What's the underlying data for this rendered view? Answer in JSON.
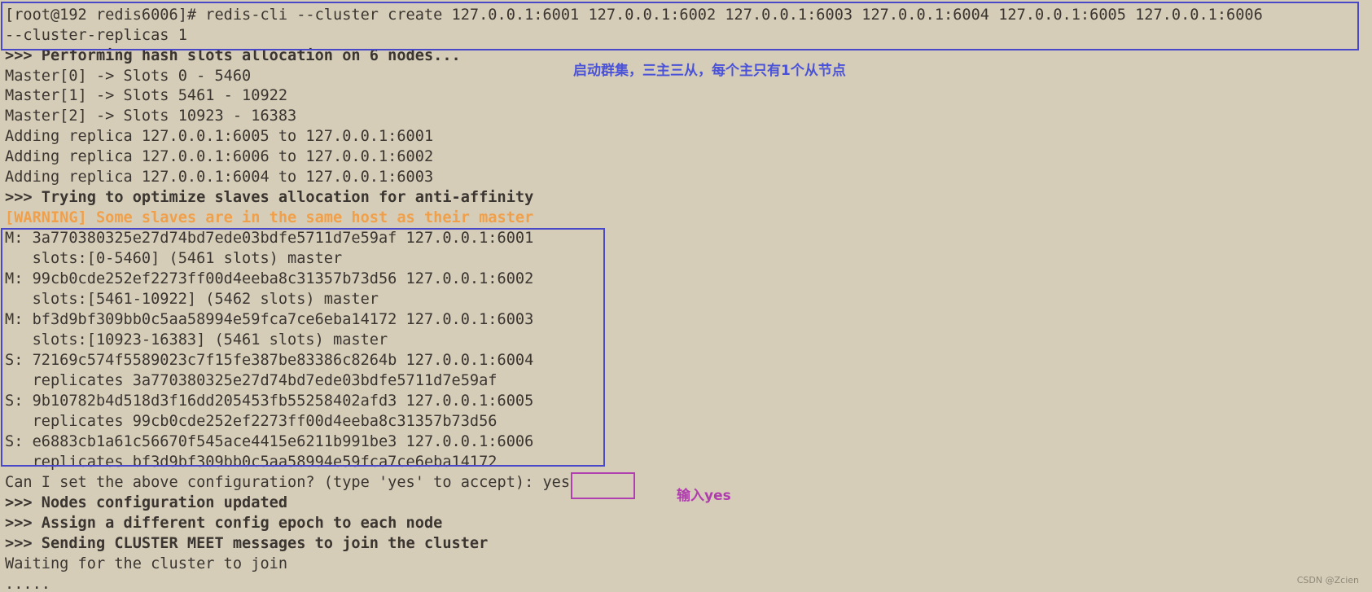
{
  "terminal": {
    "lines": [
      {
        "text": "[root@192 redis6006]# redis-cli --cluster create 127.0.0.1:6001 127.0.0.1:6002 127.0.0.1:6003 127.0.0.1:6004 127.0.0.1:6005 127.0.0.1:6006",
        "style": "normal"
      },
      {
        "text": "--cluster-replicas 1",
        "style": "normal"
      },
      {
        "text": ">>> Performing hash slots allocation on 6 nodes...",
        "style": "bold"
      },
      {
        "text": "Master[0] -> Slots 0 - 5460",
        "style": "normal"
      },
      {
        "text": "Master[1] -> Slots 5461 - 10922",
        "style": "normal"
      },
      {
        "text": "Master[2] -> Slots 10923 - 16383",
        "style": "normal"
      },
      {
        "text": "Adding replica 127.0.0.1:6005 to 127.0.0.1:6001",
        "style": "normal"
      },
      {
        "text": "Adding replica 127.0.0.1:6006 to 127.0.0.1:6002",
        "style": "normal"
      },
      {
        "text": "Adding replica 127.0.0.1:6004 to 127.0.0.1:6003",
        "style": "normal"
      },
      {
        "text": ">>> Trying to optimize slaves allocation for anti-affinity",
        "style": "bold"
      },
      {
        "text": "[WARNING] Some slaves are in the same host as their master",
        "style": "warn"
      },
      {
        "text": "M: 3a770380325e27d74bd7ede03bdfe5711d7e59af 127.0.0.1:6001",
        "style": "normal"
      },
      {
        "text": "   slots:[0-5460] (5461 slots) master",
        "style": "normal"
      },
      {
        "text": "M: 99cb0cde252ef2273ff00d4eeba8c31357b73d56 127.0.0.1:6002",
        "style": "normal"
      },
      {
        "text": "   slots:[5461-10922] (5462 slots) master",
        "style": "normal"
      },
      {
        "text": "M: bf3d9bf309bb0c5aa58994e59fca7ce6eba14172 127.0.0.1:6003",
        "style": "normal"
      },
      {
        "text": "   slots:[10923-16383] (5461 slots) master",
        "style": "normal"
      },
      {
        "text": "S: 72169c574f5589023c7f15fe387be83386c8264b 127.0.0.1:6004",
        "style": "normal"
      },
      {
        "text": "   replicates 3a770380325e27d74bd7ede03bdfe5711d7e59af",
        "style": "normal"
      },
      {
        "text": "S: 9b10782b4d518d3f16dd205453fb55258402afd3 127.0.0.1:6005",
        "style": "normal"
      },
      {
        "text": "   replicates 99cb0cde252ef2273ff00d4eeba8c31357b73d56",
        "style": "normal"
      },
      {
        "text": "S: e6883cb1a61c56670f545ace4415e6211b991be3 127.0.0.1:6006",
        "style": "normal"
      },
      {
        "text": "   replicates bf3d9bf309bb0c5aa58994e59fca7ce6eba14172",
        "style": "normal"
      },
      {
        "text": "Can I set the above configuration? (type 'yes' to accept): yes",
        "style": "normal"
      },
      {
        "text": ">>> Nodes configuration updated",
        "style": "bold"
      },
      {
        "text": ">>> Assign a different config epoch to each node",
        "style": "bold"
      },
      {
        "text": ">>> Sending CLUSTER MEET messages to join the cluster",
        "style": "bold"
      },
      {
        "text": "Waiting for the cluster to join",
        "style": "normal"
      },
      {
        "text": ".....",
        "style": "normal"
      }
    ]
  },
  "annotations": {
    "cluster_note": "启动群集，三主三从，每个主只有1个从节点",
    "yes_note": "输入yes"
  },
  "watermark": "CSDN @Zcien",
  "colors": {
    "background": "#d6cdb8",
    "text": "#3a3530",
    "warning": "#f0a04a",
    "box_blue": "#4848c8",
    "box_purple": "#b040b0"
  }
}
